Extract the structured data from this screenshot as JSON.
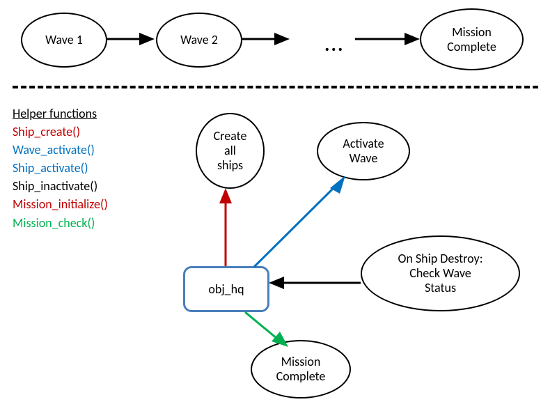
{
  "chart_data": {
    "type": "diagram",
    "top_flow": {
      "nodes": [
        "Wave 1",
        "Wave 2",
        "Mission Complete"
      ],
      "edges": [
        {
          "from": "Wave 1",
          "to": "Wave 2"
        },
        {
          "from": "Wave 2",
          "to": "..."
        },
        {
          "from": "...",
          "to": "Mission Complete"
        }
      ]
    },
    "legend": {
      "title": "Helper functions",
      "items": [
        {
          "text": "Ship_create()",
          "color": "#c00000"
        },
        {
          "text": "Wave_activate()",
          "color": "#0070c0"
        },
        {
          "text": "Ship_activate()",
          "color": "#0070c0"
        },
        {
          "text": "Ship_inactivate()",
          "color": "#000000"
        },
        {
          "text": "Mission_initialize()",
          "color": "#c00000"
        },
        {
          "text": "Mission_check()",
          "color": "#00b050"
        }
      ]
    },
    "center_node": "obj_hq",
    "surrounding_nodes": [
      {
        "label": "Create all ships",
        "edge_color": "#c00000",
        "direction": "out"
      },
      {
        "label": "Activate Wave",
        "edge_color": "#0070c0",
        "direction": "out"
      },
      {
        "label": "On Ship Destroy: Check Wave Status",
        "edge_color": "#000000",
        "direction": "in"
      },
      {
        "label": "Mission Complete",
        "edge_color": "#00b050",
        "direction": "out"
      }
    ]
  },
  "top": {
    "wave1": "Wave 1",
    "wave2": "Wave 2",
    "ellipsis": "...",
    "mission_complete": "Mission\nComplete"
  },
  "legend": {
    "title": "Helper functions",
    "f0": "Ship_create()",
    "f1": "Wave_activate()",
    "f2": "Ship_activate()",
    "f3": "Ship_inactivate()",
    "f4": "Mission_initialize()",
    "f5": "Mission_check()"
  },
  "center": "obj_hq",
  "nodes": {
    "create_ships": "Create\nall\nships",
    "activate_wave": "Activate\nWave",
    "on_destroy": "On Ship Destroy:\nCheck Wave\nStatus",
    "mission_complete2": "Mission\nComplete"
  }
}
